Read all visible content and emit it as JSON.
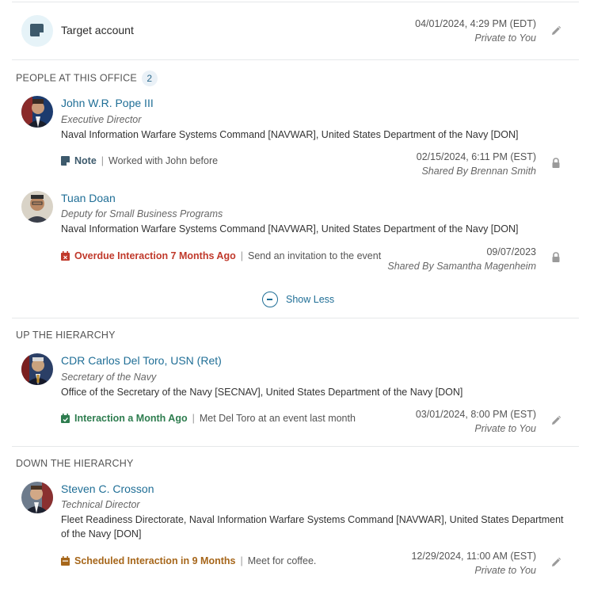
{
  "target": {
    "label": "Target account",
    "timestamp": "04/01/2024, 4:29 PM (EDT)",
    "visibility": "Private to You"
  },
  "people_section": {
    "title": "PEOPLE AT THIS OFFICE",
    "count": "2",
    "people": [
      {
        "name": "John W.R. Pope III",
        "title": "Executive Director",
        "org": "Naval Information Warfare Systems Command [NAVWAR], United States Department of the Navy [DON]",
        "activity": {
          "kind": "note",
          "label": "Note",
          "text": "Worked with John before",
          "timestamp": "02/15/2024, 6:11 PM (EST)",
          "shared": "Shared By Brennan Smith",
          "color": "#3d5a6c"
        }
      },
      {
        "name": "Tuan Doan",
        "title": "Deputy for Small Business Programs",
        "org": "Naval Information Warfare Systems Command [NAVWAR], United States Department of the Navy [DON]",
        "activity": {
          "kind": "overdue",
          "label": "Overdue Interaction 7 Months Ago",
          "text": "Send an invitation to the event",
          "timestamp": "09/07/2023",
          "shared": "Shared By Samantha Magenheim",
          "color": "#c0392b"
        }
      }
    ],
    "show_less": "Show Less"
  },
  "up_section": {
    "title": "UP THE HIERARCHY",
    "person": {
      "name": "CDR Carlos Del Toro, USN (Ret)",
      "title": "Secretary of the Navy",
      "org": "Office of the Secretary of the Navy [SECNAV], United States Department of the Navy [DON]",
      "activity": {
        "kind": "completed",
        "label": "Interaction a Month Ago",
        "text": "Met Del Toro at an event last month",
        "timestamp": "03/01/2024, 8:00 PM (EST)",
        "visibility": "Private to You",
        "color": "#2e7d4f"
      }
    }
  },
  "down_section": {
    "title": "DOWN THE HIERARCHY",
    "person": {
      "name": "Steven C. Crosson",
      "title": "Technical Director",
      "org": "Fleet Readiness Directorate, Naval Information Warfare Systems Command [NAVWAR], United States Department of the Navy [DON]",
      "activity": {
        "kind": "scheduled",
        "label": "Scheduled Interaction in 9 Months",
        "text": "Meet for coffee.",
        "timestamp": "12/29/2024, 11:00 AM (EST)",
        "visibility": "Private to You",
        "color": "#a6661a"
      }
    }
  },
  "icons": {
    "target": "note-icon",
    "edit": "pencil-icon",
    "lock": "lock-icon",
    "collapse": "minus-circle-icon"
  }
}
